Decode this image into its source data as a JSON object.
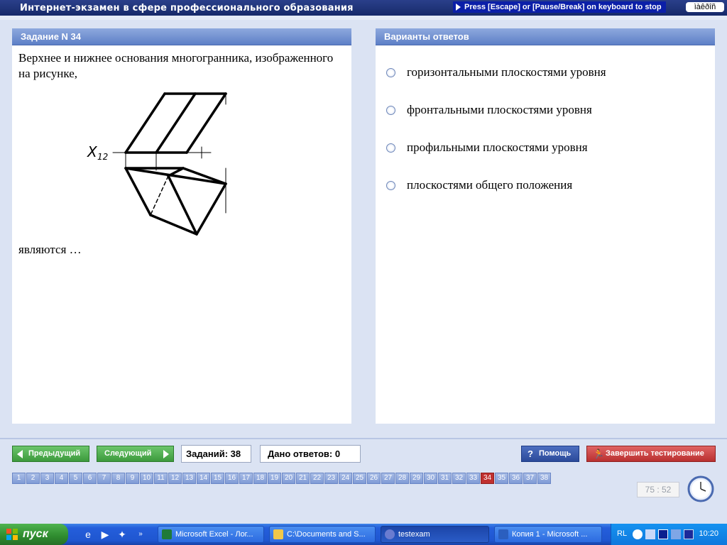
{
  "window": {
    "title": "Интернет-экзамен в сфере профессионального образования",
    "escape_hint": "Press [Escape] or [Pause/Break] on keyboard to stop",
    "lang_indicator": "ìàêðîñ"
  },
  "task": {
    "header": "Задание N 34",
    "text": "Верхнее и нижнее основания многогранника, изображенного на рисунке,",
    "text_tail": "являются …",
    "figure_label": "X12"
  },
  "answers": {
    "header": "Варианты ответов",
    "options": [
      "горизонтальными плоскостями уровня",
      "фронтальными плоскостями уровня",
      "профильными плоскостями уровня",
      "плоскостями общего положения"
    ]
  },
  "controls": {
    "prev_label": "Предыдущий",
    "next_label": "Следующий",
    "tasks_count": "Заданий: 38",
    "answers_given": "Дано ответов: 0",
    "help_label": "Помощь",
    "finish_label": "Завершить тестирование",
    "task_numbers": [
      "1",
      "2",
      "3",
      "4",
      "5",
      "6",
      "7",
      "8",
      "9",
      "10",
      "11",
      "12",
      "13",
      "14",
      "15",
      "16",
      "17",
      "18",
      "19",
      "20",
      "21",
      "22",
      "23",
      "24",
      "25",
      "26",
      "27",
      "28",
      "29",
      "30",
      "31",
      "32",
      "33",
      "34",
      "35",
      "36",
      "37",
      "38"
    ],
    "current_task": "34",
    "timer": "75 : 52"
  },
  "taskbar": {
    "start_label": "пуск",
    "buttons": [
      {
        "label": "Microsoft Excel - Лог...",
        "icon": "excel-icon"
      },
      {
        "label": "C:\\Documents and S...",
        "icon": "folder-icon"
      },
      {
        "label": "testexam",
        "icon": "app-icon"
      },
      {
        "label": "Копия 1 - Microsoft ...",
        "icon": "word-icon"
      }
    ],
    "lang": "RL",
    "time": "10:20"
  },
  "colors": {
    "header_blue": "#5d7fc7",
    "current_task_red": "#c0302f",
    "finish_red": "#b93030",
    "nav_green": "#3c9a3c"
  }
}
